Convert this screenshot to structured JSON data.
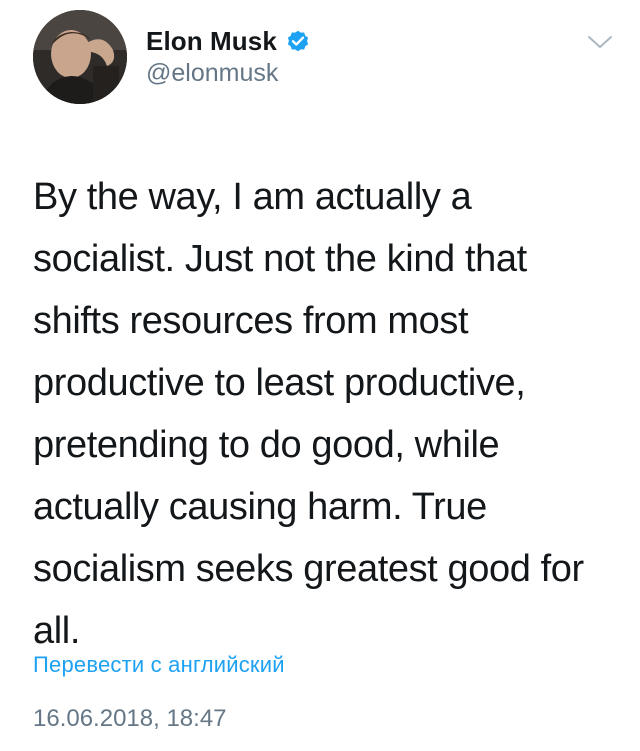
{
  "author": {
    "display_name": "Elon Musk",
    "handle": "@elonmusk",
    "verified": true
  },
  "tweet": {
    "text": "By the way, I am actually a\nsocialist. Just not the kind that\nshifts resources from most\nproductive to least productive,\npretending to do good, while\nactually causing harm. True\nsocialism seeks greatest good for\nall.",
    "translate_label": "Перевести с английский",
    "timestamp": "16.06.2018, 18:47"
  },
  "icons": {
    "verified": "verified-badge-icon",
    "more": "chevron-down-icon"
  },
  "colors": {
    "accent": "#1da1f2",
    "text": "#14171a",
    "secondary": "#657786"
  }
}
